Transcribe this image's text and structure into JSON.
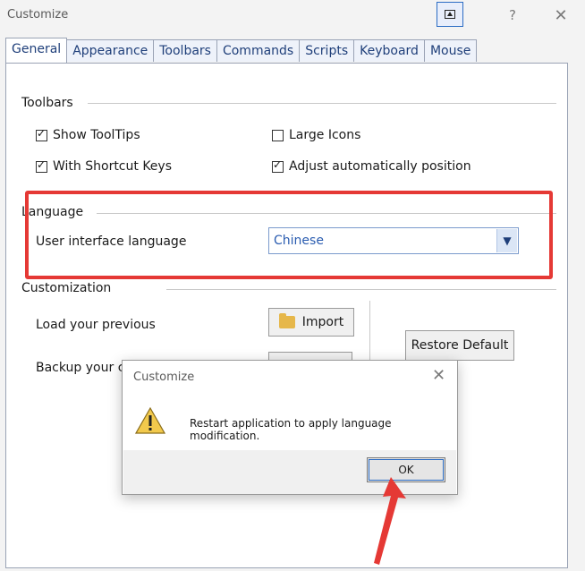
{
  "window": {
    "title": "Customize",
    "help_label": "?",
    "close_label": "✕"
  },
  "tabs": [
    {
      "label": "General",
      "active": true
    },
    {
      "label": "Appearance",
      "active": false
    },
    {
      "label": "Toolbars",
      "active": false
    },
    {
      "label": "Commands",
      "active": false
    },
    {
      "label": "Scripts",
      "active": false
    },
    {
      "label": "Keyboard",
      "active": false
    },
    {
      "label": "Mouse",
      "active": false
    }
  ],
  "toolbars_group": {
    "label": "Toolbars",
    "show_tooltips": {
      "label": "Show ToolTips",
      "checked": true
    },
    "large_icons": {
      "label": "Large Icons",
      "checked": false
    },
    "with_shortcut_keys": {
      "label": "With Shortcut Keys",
      "checked": true
    },
    "adjust_position": {
      "label": "Adjust automatically position",
      "checked": true
    }
  },
  "language_group": {
    "label": "Language",
    "ui_language_label": "User interface language",
    "ui_language_value": "Chinese"
  },
  "customization_group": {
    "label": "Customization",
    "load_label": "Load your previous",
    "backup_label": "Backup your c",
    "import_label": "Import",
    "restore_label": "Restore Default"
  },
  "dialog": {
    "title": "Customize",
    "close_label": "✕",
    "message": "Restart application to apply language modification.",
    "ok_label": "OK"
  },
  "colors": {
    "annotation": "#e53935",
    "accent": "#2b6cc4"
  }
}
